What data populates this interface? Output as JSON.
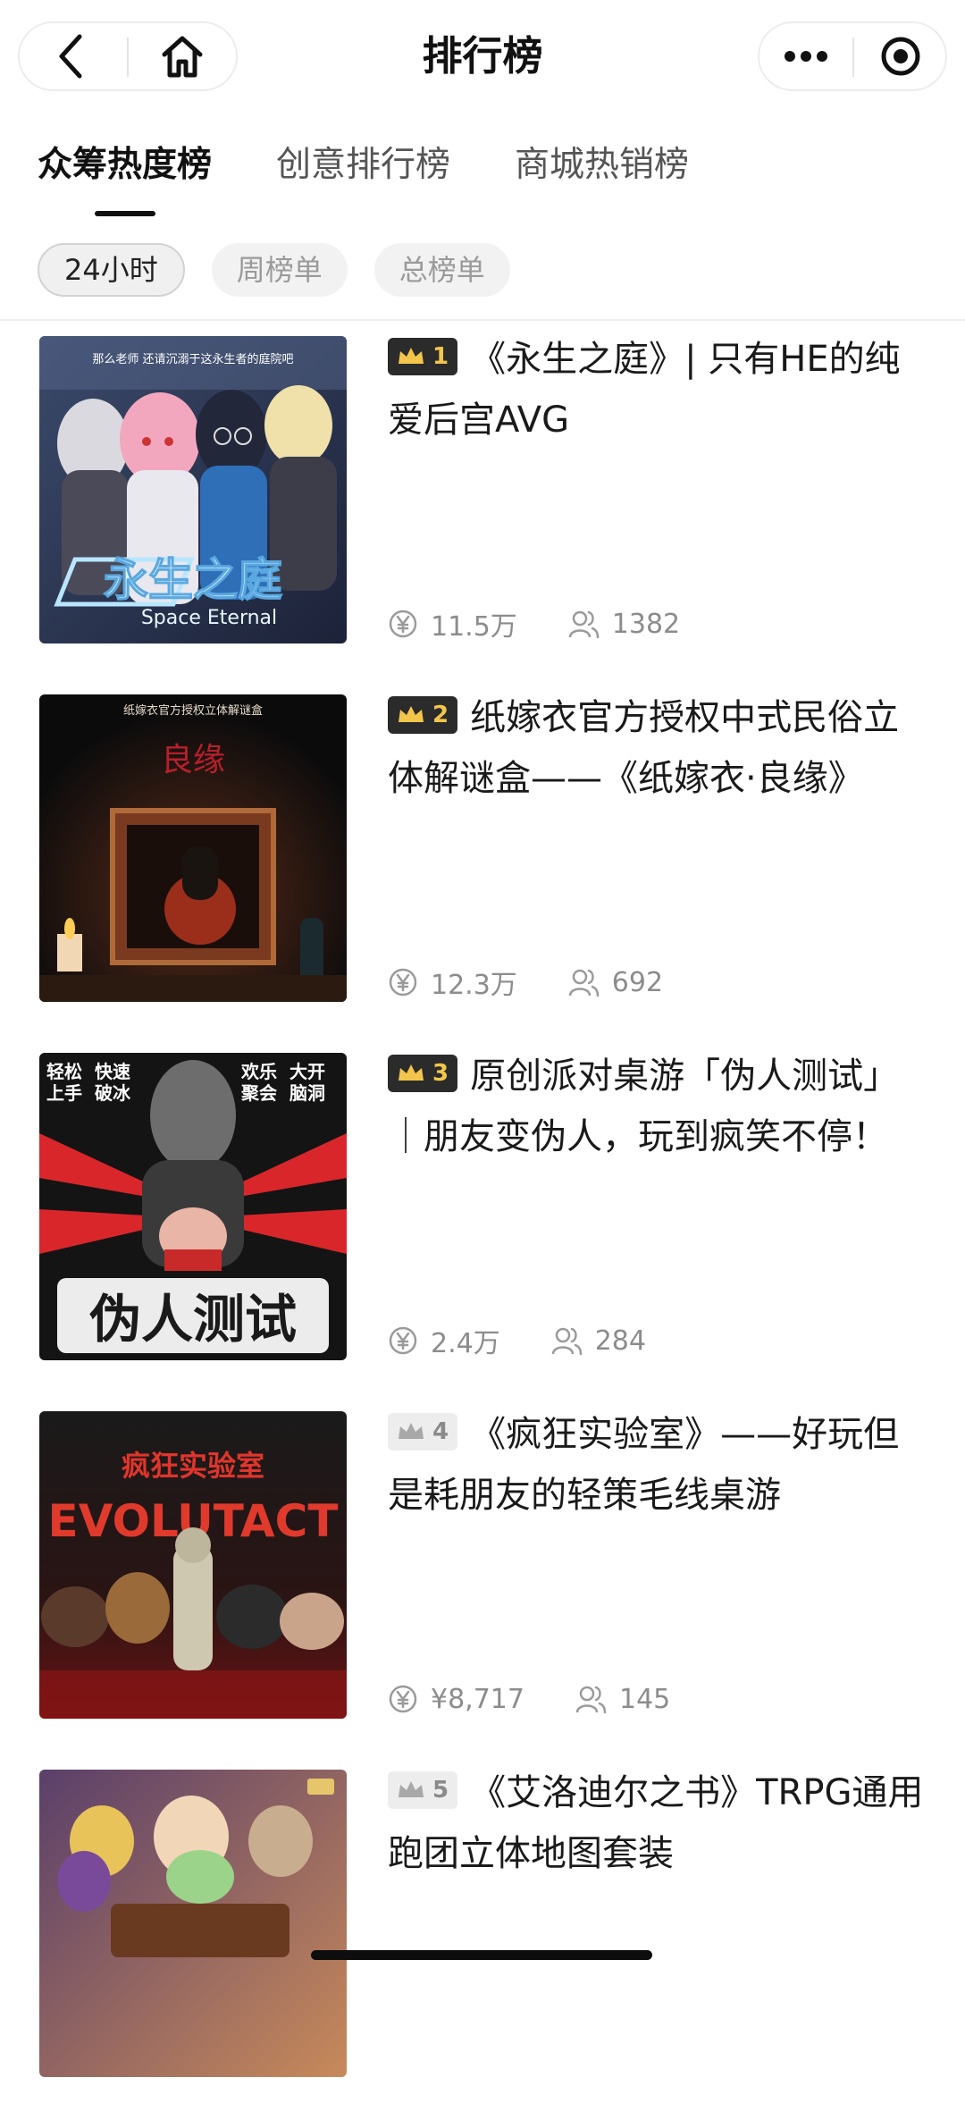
{
  "header": {
    "title": "排行榜",
    "icons": [
      "back-icon",
      "home-icon",
      "more-icon",
      "target-icon"
    ]
  },
  "tabs": [
    {
      "label": "众筹热度榜",
      "active": true
    },
    {
      "label": "创意排行榜",
      "active": false
    },
    {
      "label": "商城热销榜",
      "active": false
    }
  ],
  "filters": [
    {
      "label": "24小时",
      "active": true
    },
    {
      "label": "周榜单",
      "active": false
    },
    {
      "label": "总榜单",
      "active": false
    }
  ],
  "items": [
    {
      "rank": "1",
      "badge": "gold",
      "title": "《永生之庭》| 只有HE的纯爱后宫AVG",
      "amount": "11.5万",
      "supporters": "1382",
      "cover_text": "Space Eternal",
      "cover_logo": "永生之庭",
      "cover_caption": "那么老师 还请沉溺于这永生者的庭院吧"
    },
    {
      "rank": "2",
      "badge": "gold",
      "title": "纸嫁衣官方授权中式民俗立体解谜盒——《纸嫁衣·良缘》",
      "amount": "12.3万",
      "supporters": "692",
      "cover_caption": "纸嫁衣官方授权立体解谜盒",
      "cover_logo": "良缘"
    },
    {
      "rank": "3",
      "badge": "gold",
      "title": "原创派对桌游「伪人测试」｜朋友变伪人，玩到疯笑不停！",
      "amount": "2.4万",
      "supporters": "284",
      "cover_tags": [
        "轻松",
        "快速",
        "欢乐",
        "大开",
        "上手",
        "破冰",
        "聚会",
        "脑洞"
      ],
      "cover_logo": "伪人测试"
    },
    {
      "rank": "4",
      "badge": "grey",
      "title": "《疯狂实验室》——好玩但是耗朋友的轻策毛线桌游",
      "amount": "¥8,717",
      "supporters": "145",
      "cover_caption": "疯狂实验室",
      "cover_logo": "EVOLUTACT"
    },
    {
      "rank": "5",
      "badge": "grey",
      "title": "《艾洛迪尔之书》TRPG通用跑团立体地图套装",
      "amount": "",
      "supporters": ""
    }
  ],
  "colors": {
    "gold_badge_bg": "#2b2b2b",
    "gold_crown": "#f3c64b",
    "grey_badge_bg": "#ededed",
    "stat_text": "#8c8c8c"
  }
}
